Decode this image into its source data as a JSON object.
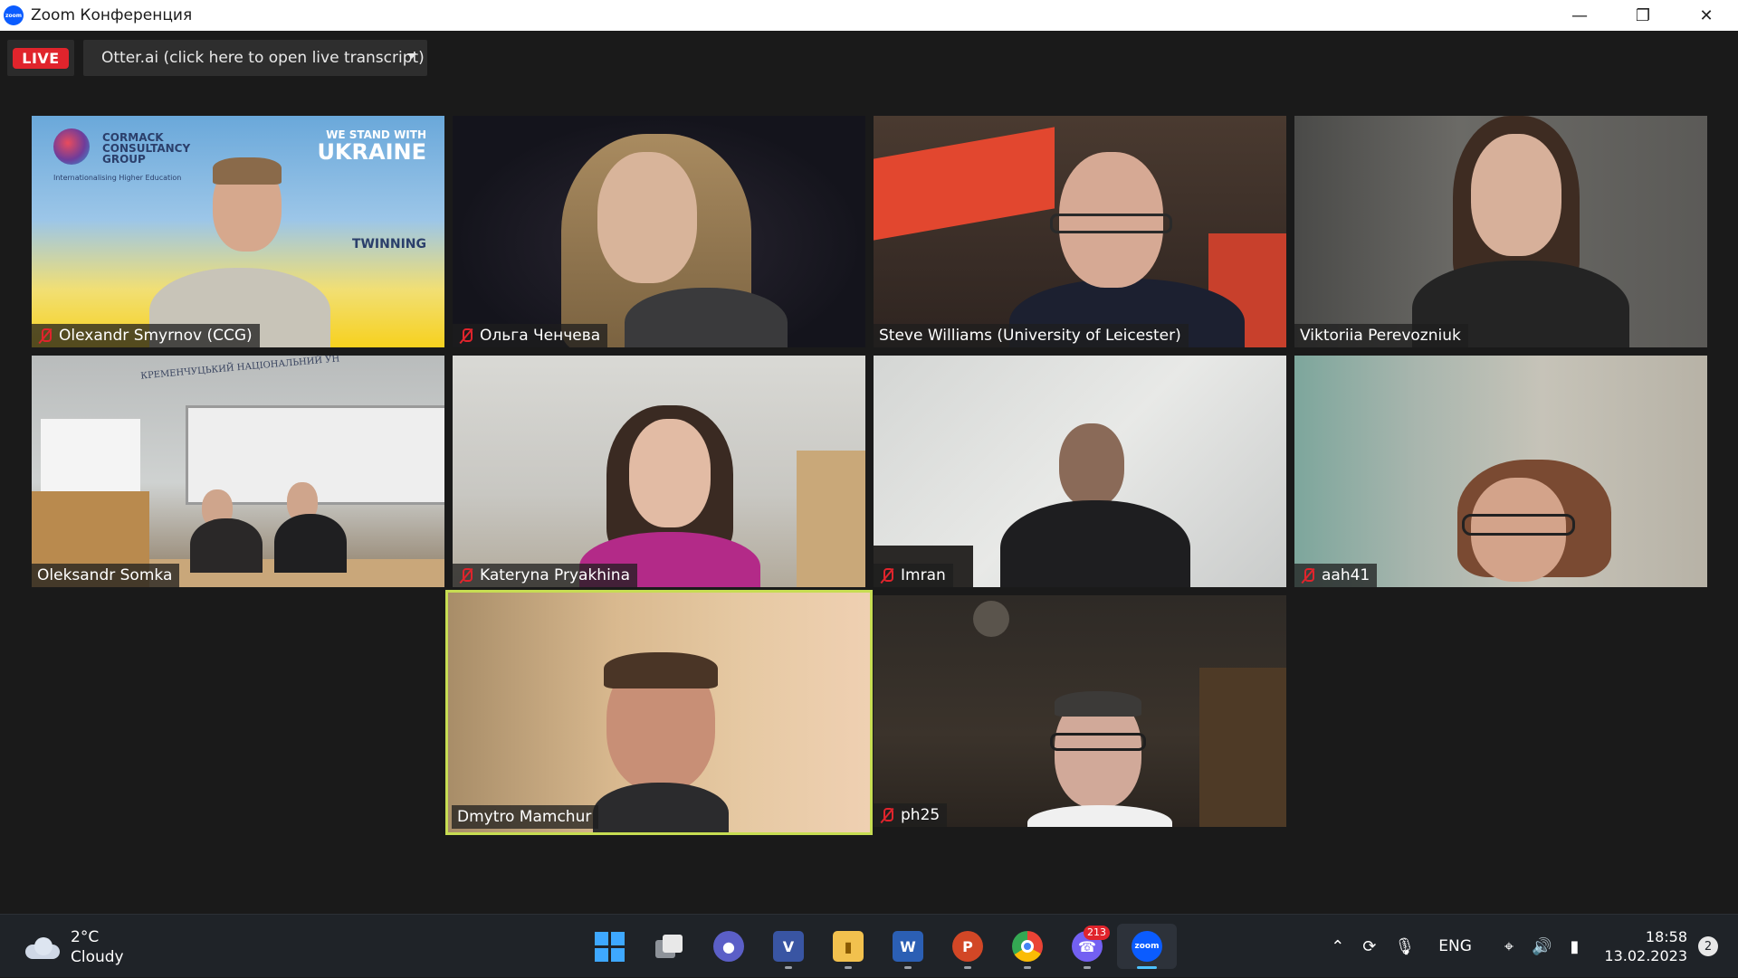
{
  "window": {
    "title": "Zoom Конференция",
    "app_icon_text": "zoom"
  },
  "live": {
    "badge": "LIVE",
    "otter_label": "Otter.ai (click here to open live transcript)"
  },
  "ccg_tile": {
    "logo_line1": "CORMACK",
    "logo_line2": "CONSULTANCY",
    "logo_line3": "GROUP",
    "logo_tagline": "Internationalising Higher Education",
    "stand_line1": "WE STAND WITH",
    "stand_line2": "UKRAINE",
    "twinning": "TWINNING"
  },
  "room_sign": "КРЕМЕНЧУЦЬКИЙ НАЦІОНАЛЬНИЙ УН",
  "participants": [
    {
      "name": "Olexandr Smyrnov (CCG)",
      "muted": true
    },
    {
      "name": "Ольга Ченчева",
      "muted": true
    },
    {
      "name": "Steve Williams (University of Leicester)",
      "muted": false
    },
    {
      "name": "Viktoriia Perevozniuk",
      "muted": false
    },
    {
      "name": "Oleksandr Somka",
      "muted": false
    },
    {
      "name": "Kateryna Pryakhina",
      "muted": true
    },
    {
      "name": "Imran",
      "muted": true
    },
    {
      "name": "aah41",
      "muted": true
    },
    {
      "name": "Dmytro Mamchur",
      "muted": false,
      "active_speaker": true
    },
    {
      "name": "ph25",
      "muted": true
    }
  ],
  "taskbar": {
    "weather_temp": "2°C",
    "weather_desc": "Cloudy",
    "viber_badge": "213",
    "zoom_label": "zoom",
    "lang": "ENG",
    "time": "18:58",
    "date": "13.02.2023",
    "notifications": "2"
  },
  "colors": {
    "accent_live": "#e0242c",
    "active_speaker": "#c7dd52",
    "taskbar": "#1f2328"
  }
}
